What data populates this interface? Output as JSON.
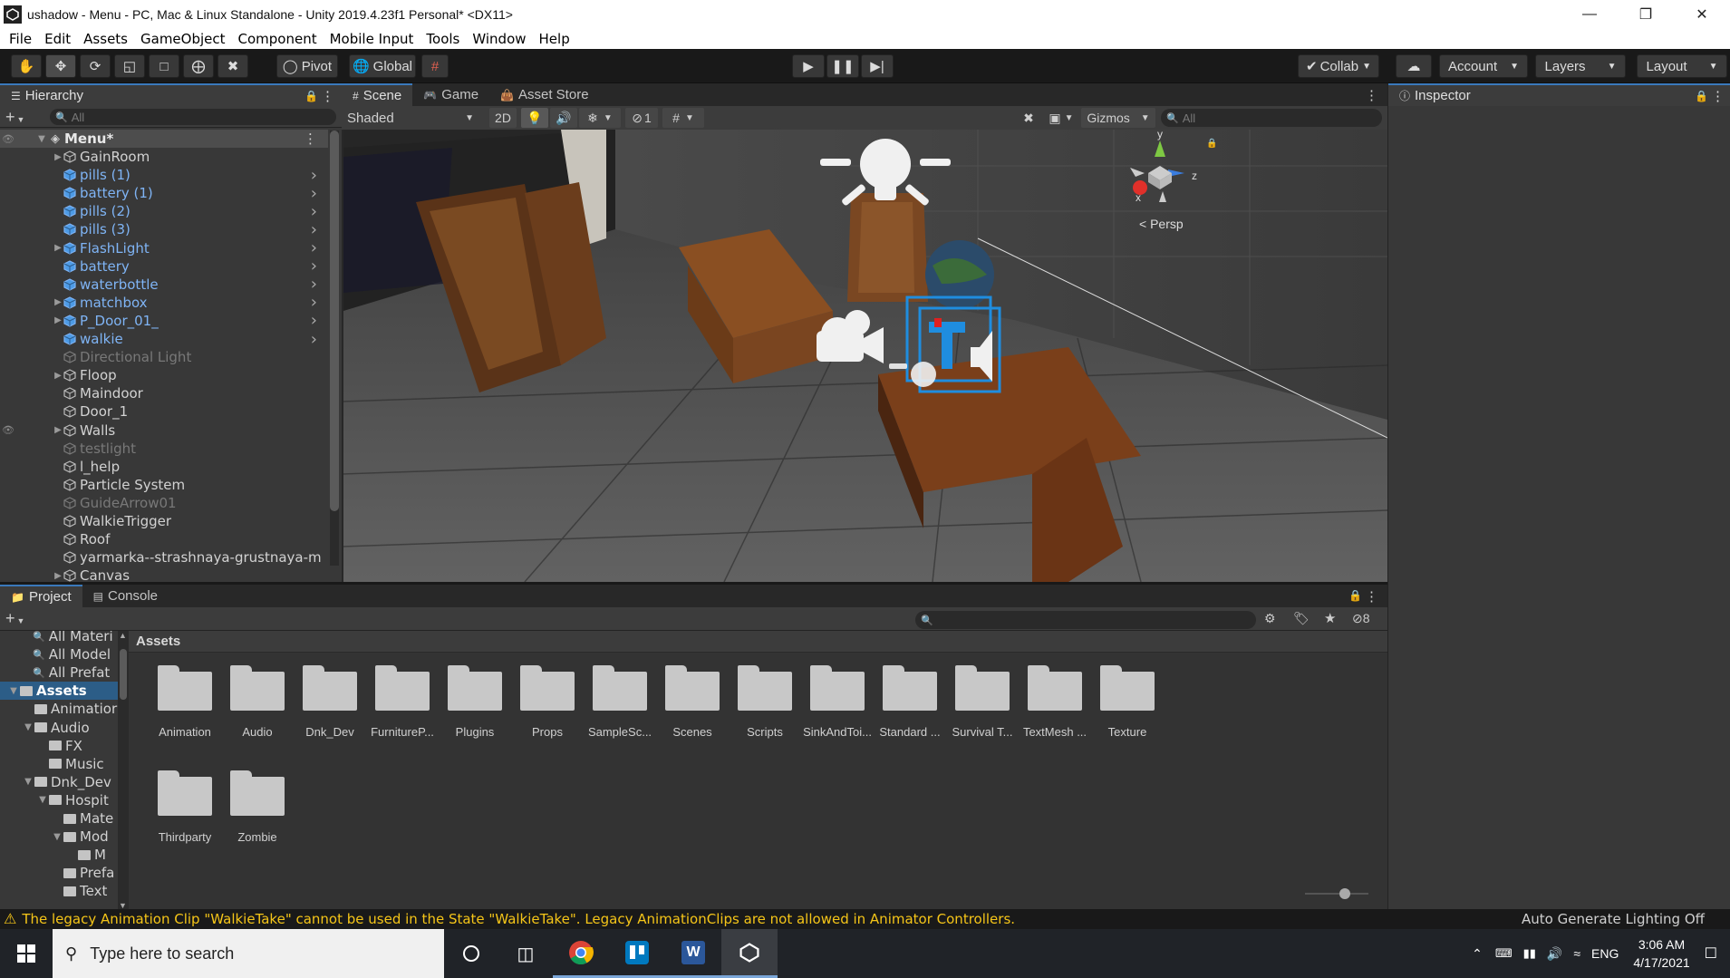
{
  "window": {
    "title": "ushadow - Menu - PC, Mac & Linux Standalone - Unity 2019.4.23f1 Personal* <DX11>"
  },
  "menu": [
    "File",
    "Edit",
    "Assets",
    "GameObject",
    "Component",
    "Mobile Input",
    "Tools",
    "Window",
    "Help"
  ],
  "toolbar": {
    "pivot": "Pivot",
    "global": "Global",
    "collab": "Collab",
    "account": "Account",
    "layers": "Layers",
    "layout": "Layout"
  },
  "hierarchy": {
    "tab": "Hierarchy",
    "search_placeholder": "All",
    "scene": "Menu*",
    "items": [
      {
        "label": "GainRoom",
        "kind": "normal",
        "arrow": true,
        "chev": false
      },
      {
        "label": "pills (1)",
        "kind": "prefab",
        "arrow": false,
        "chev": true
      },
      {
        "label": "battery (1)",
        "kind": "prefab",
        "arrow": false,
        "chev": true
      },
      {
        "label": "pills (2)",
        "kind": "prefab",
        "arrow": false,
        "chev": true
      },
      {
        "label": "pills (3)",
        "kind": "prefab",
        "arrow": false,
        "chev": true
      },
      {
        "label": "FlashLight",
        "kind": "prefab",
        "arrow": true,
        "chev": true
      },
      {
        "label": "battery",
        "kind": "prefab",
        "arrow": false,
        "chev": true
      },
      {
        "label": "waterbottle",
        "kind": "prefab",
        "arrow": false,
        "chev": true
      },
      {
        "label": "matchbox",
        "kind": "prefab",
        "arrow": true,
        "chev": true
      },
      {
        "label": "P_Door_01_",
        "kind": "prefab",
        "arrow": true,
        "chev": true
      },
      {
        "label": "walkie",
        "kind": "prefab",
        "arrow": false,
        "chev": true
      },
      {
        "label": "Directional Light",
        "kind": "dim",
        "arrow": false,
        "chev": false
      },
      {
        "label": "Floop",
        "kind": "normal",
        "arrow": true,
        "chev": false
      },
      {
        "label": "Maindoor",
        "kind": "normal",
        "arrow": false,
        "chev": false
      },
      {
        "label": "Door_1",
        "kind": "normal",
        "arrow": false,
        "chev": false
      },
      {
        "label": "Walls",
        "kind": "normal",
        "arrow": true,
        "chev": false
      },
      {
        "label": "testlight",
        "kind": "dim",
        "arrow": false,
        "chev": false
      },
      {
        "label": "l_help",
        "kind": "normal",
        "arrow": false,
        "chev": false
      },
      {
        "label": "Particle System",
        "kind": "normal",
        "arrow": false,
        "chev": false
      },
      {
        "label": "GuideArrow01",
        "kind": "dim",
        "arrow": false,
        "chev": false
      },
      {
        "label": "WalkieTrigger",
        "kind": "normal",
        "arrow": false,
        "chev": false
      },
      {
        "label": "Roof",
        "kind": "normal",
        "arrow": false,
        "chev": false
      },
      {
        "label": "yarmarka--strashnaya-grustnaya-m",
        "kind": "normal",
        "arrow": false,
        "chev": false
      },
      {
        "label": "Canvas",
        "kind": "normal",
        "arrow": true,
        "chev": false
      }
    ]
  },
  "scene": {
    "tabs": [
      "Scene",
      "Game",
      "Asset Store"
    ],
    "shading": "Shaded",
    "mode2d": "2D",
    "hidden_count": "1",
    "gizmos": "Gizmos",
    "search_placeholder": "All",
    "persp": "Persp",
    "axes": {
      "x": "x",
      "y": "y",
      "z": "z"
    }
  },
  "inspector": {
    "tab": "Inspector"
  },
  "project": {
    "tabs": [
      "Project",
      "Console"
    ],
    "breadcrumb": "Assets",
    "hidden_count": "8",
    "tree": [
      {
        "label": "All Materi",
        "indent": 0,
        "type": "search"
      },
      {
        "label": "All Model",
        "indent": 0,
        "type": "search"
      },
      {
        "label": "All Prefat",
        "indent": 0,
        "type": "search"
      },
      {
        "label": "Assets",
        "indent": 0,
        "type": "root"
      },
      {
        "label": "Animatior",
        "indent": 1,
        "type": "folder"
      },
      {
        "label": "Audio",
        "indent": 1,
        "type": "open"
      },
      {
        "label": "FX",
        "indent": 2,
        "type": "folder"
      },
      {
        "label": "Music",
        "indent": 2,
        "type": "folder"
      },
      {
        "label": "Dnk_Dev",
        "indent": 1,
        "type": "open"
      },
      {
        "label": "Hospit",
        "indent": 2,
        "type": "open"
      },
      {
        "label": "Mate",
        "indent": 3,
        "type": "folder"
      },
      {
        "label": "Mod",
        "indent": 3,
        "type": "open"
      },
      {
        "label": "M",
        "indent": 4,
        "type": "folder"
      },
      {
        "label": "Prefa",
        "indent": 3,
        "type": "folder"
      },
      {
        "label": "Text",
        "indent": 3,
        "type": "folder"
      }
    ],
    "folders": [
      "Animation",
      "Audio",
      "Dnk_Dev",
      "FurnitureP...",
      "Plugins",
      "Props",
      "SampleSc...",
      "Scenes",
      "Scripts",
      "SinkAndToi...",
      "Standard ...",
      "Survival T...",
      "TextMesh ...",
      "Texture",
      "Thirdparty",
      "Zombie"
    ]
  },
  "status": {
    "message": "The legacy Animation Clip \"WalkieTake\" cannot be used in the State \"WalkieTake\". Legacy AnimationClips are not allowed in Animator Controllers.",
    "right": "Auto Generate Lighting Off",
    "warn_color": "#f5c518"
  },
  "taskbar": {
    "search": "Type here to search",
    "lang": "ENG",
    "time": "3:06 AM",
    "date": "4/17/2021"
  }
}
